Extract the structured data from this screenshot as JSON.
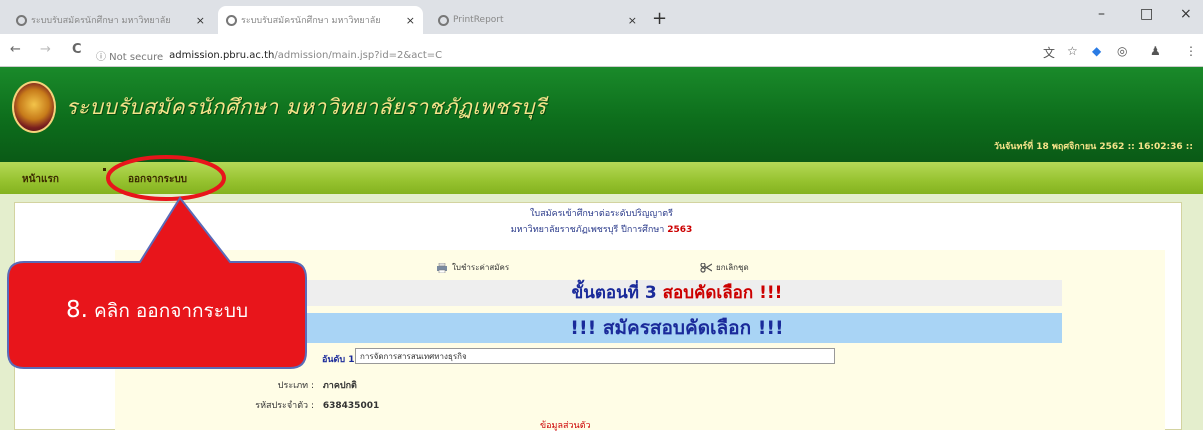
{
  "browser": {
    "tabs": [
      {
        "title": "ระบบรับสมัครนักศึกษา มหาวิทยาลัย"
      },
      {
        "title": "ระบบรับสมัครนักศึกษา มหาวิทยาลัย"
      },
      {
        "title": "PrintReport"
      }
    ],
    "window_controls": {
      "minimize": "–",
      "maximize": "□",
      "close": "×"
    },
    "new_tab": "+",
    "nav": {
      "back": "←",
      "forward": "→",
      "reload": "C"
    },
    "url": {
      "security": "ⓘ Not secure",
      "host": "admission.pbru.ac.th",
      "path": "/admission/main.jsp?id=2&act=C"
    }
  },
  "site": {
    "name": "ระบบรับสมัครนักศึกษา มหาวิทยาลัยราชภัฏเพชรบุรี",
    "datetime": "วันจันทร์ที่ 18 พฤศจิกายน 2562 :: 16:02:36 ::",
    "menu": [
      {
        "label": "หน้าแรก"
      },
      {
        "label": "ออกจากระบบ"
      }
    ]
  },
  "form": {
    "heading1": "ใบสมัครเข้าศึกษาต่อระดับปริญญาตรี",
    "heading2_prefix": "มหาวิทยาลัยราชภัฏเพชรบุรี ปีการศึกษา",
    "year": "2563",
    "links": {
      "print": "ใบชำระค่าสมัคร",
      "cancel": "ยกเลิกชุด"
    },
    "step_prefix": "ขั้นตอนที่ 3",
    "step_suffix": "สอบคัดเลือก !!!",
    "apply_title": "!!! สมัครสอบคัดเลือก !!!",
    "choice_label": "อันดับ 1 :",
    "choice_value": "การจัดการสารสนเทศทางธุรกิจ",
    "type_label": "ประเภท :",
    "type_value": "ภาคปกติ",
    "id_label": "รหัสประจำตัว :",
    "id_value": "638435001",
    "section_red": "ข้อมูลส่วนตัว"
  },
  "callout": {
    "number": "8.",
    "text": "คลิก ออกจากระบบ",
    "fill": "#e8151b",
    "ring": "#e8151b"
  },
  "colors": {
    "header_green": "#0d6e1c",
    "menu_green": "#96c22f",
    "link_blue": "#1a2a9a",
    "alert_red": "#cc0000"
  }
}
